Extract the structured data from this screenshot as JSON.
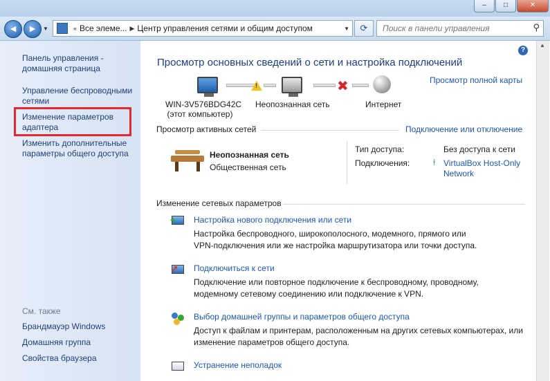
{
  "window": {
    "min": "–",
    "max": "□",
    "close": "✕"
  },
  "nav": {
    "back": "◄",
    "forward": "►",
    "address_part1": "Все элеме...",
    "address_part2": "Центр управления сетями и общим доступом",
    "search_placeholder": "Поиск в панели управления"
  },
  "sidebar": {
    "items": [
      {
        "line1": "Панель управления -",
        "line2": "домашняя страница"
      },
      {
        "line1": "Управление беспроводными",
        "line2": "сетями"
      },
      {
        "line1": "Изменение параметров",
        "line2": "адаптера"
      },
      {
        "line1": "Изменить дополнительные",
        "line2": "параметры общего доступа"
      }
    ],
    "see_also": "См. также",
    "see_also_items": [
      "Брандмауэр Windows",
      "Домашняя группа",
      "Свойства браузера"
    ]
  },
  "main": {
    "help": "?",
    "title": "Просмотр основных сведений о сети и настройка подключений",
    "full_map": "Просмотр полной карты",
    "map": {
      "computer_line1": "WIN-3V576BDG42C",
      "computer_line2": "(этот компьютер)",
      "network": "Неопознанная сеть",
      "internet": "Интернет"
    },
    "active_header": "Просмотр активных сетей",
    "connect_toggle": "Подключение или отключение",
    "active_network": {
      "name": "Неопознанная сеть",
      "type": "Общественная сеть",
      "access_label": "Тип доступа:",
      "access_value": "Без доступа к сети",
      "connections_label": "Подключения:",
      "connection_line1": "VirtualBox Host-Only",
      "connection_line2": "Network"
    },
    "settings_header": "Изменение сетевых параметров",
    "tasks": [
      {
        "title": "Настройка нового подключения или сети",
        "line1": "Настройка беспроводного, широкополосного, модемного, прямого или",
        "line2": "VPN-подключения или же настройка маршрутизатора или точки доступа."
      },
      {
        "title": "Подключиться к сети",
        "line1": "Подключение или повторное подключение к беспроводному, проводному,",
        "line2": "модемному сетевому соединению или подключение к VPN."
      },
      {
        "title": "Выбор домашней группы и параметров общего доступа",
        "line1": "Доступ к файлам и принтерам, расположенным на других сетевых компьютерах, или",
        "line2": "изменение параметров общего доступа."
      },
      {
        "title": "Устранение неполадок"
      }
    ]
  },
  "colors": {
    "link": "#1c56b8",
    "title": "#1c3d8a",
    "highlight": "#e8262f"
  }
}
